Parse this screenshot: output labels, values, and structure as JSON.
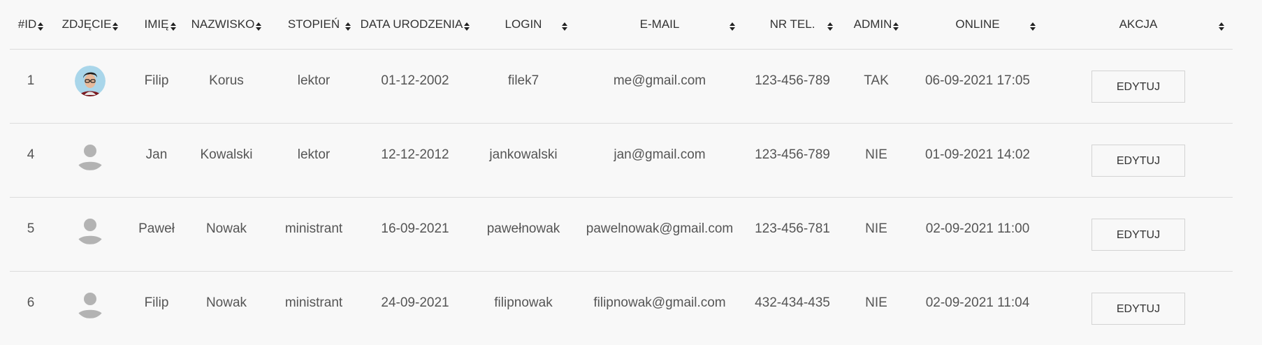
{
  "table": {
    "headers": [
      {
        "key": "id",
        "label": "#ID"
      },
      {
        "key": "photo",
        "label": "ZDJĘCIE"
      },
      {
        "key": "first_name",
        "label": "IMIĘ"
      },
      {
        "key": "last_name",
        "label": "NAZWISKO"
      },
      {
        "key": "rank",
        "label": "STOPIEŃ"
      },
      {
        "key": "birth_date",
        "label": "DATA URODZENIA"
      },
      {
        "key": "login",
        "label": "LOGIN"
      },
      {
        "key": "email",
        "label": "E-MAIL"
      },
      {
        "key": "phone",
        "label": "NR TEL."
      },
      {
        "key": "admin",
        "label": "ADMIN"
      },
      {
        "key": "online",
        "label": "ONLINE"
      },
      {
        "key": "action",
        "label": "AKCJA"
      }
    ],
    "rows": [
      {
        "id": "1",
        "photo": "user-photo",
        "first_name": "Filip",
        "last_name": "Korus",
        "rank": "lektor",
        "birth_date": "01-12-2002",
        "login": "filek7",
        "email": "me@gmail.com",
        "phone": "123-456-789",
        "admin": "TAK",
        "online": "06-09-2021 17:05",
        "action": "EDYTUJ"
      },
      {
        "id": "4",
        "photo": "default-avatar",
        "first_name": "Jan",
        "last_name": "Kowalski",
        "rank": "lektor",
        "birth_date": "12-12-2012",
        "login": "jankowalski",
        "email": "jan@gmail.com",
        "phone": "123-456-789",
        "admin": "NIE",
        "online": "01-09-2021 14:02",
        "action": "EDYTUJ"
      },
      {
        "id": "5",
        "photo": "default-avatar",
        "first_name": "Paweł",
        "last_name": "Nowak",
        "rank": "ministrant",
        "birth_date": "16-09-2021",
        "login": "pawełnowak",
        "email": "pawelnowak@gmail.com",
        "phone": "123-456-781",
        "admin": "NIE",
        "online": "02-09-2021 11:00",
        "action": "EDYTUJ"
      },
      {
        "id": "6",
        "photo": "default-avatar",
        "first_name": "Filip",
        "last_name": "Nowak",
        "rank": "ministrant",
        "birth_date": "24-09-2021",
        "login": "filipnowak",
        "email": "filipnowak@gmail.com",
        "phone": "432-434-435",
        "admin": "NIE",
        "online": "02-09-2021 11:04",
        "action": "EDYTUJ"
      }
    ]
  },
  "colors": {
    "background": "#f8f8f8",
    "divider": "#dcdcdc",
    "text": "#555555",
    "header_text": "#333333",
    "avatar_placeholder": "#b3b3b3"
  },
  "icons": {
    "sort": "sort-icon",
    "photo": "user-photo-icon",
    "default_avatar": "default-avatar-icon"
  }
}
